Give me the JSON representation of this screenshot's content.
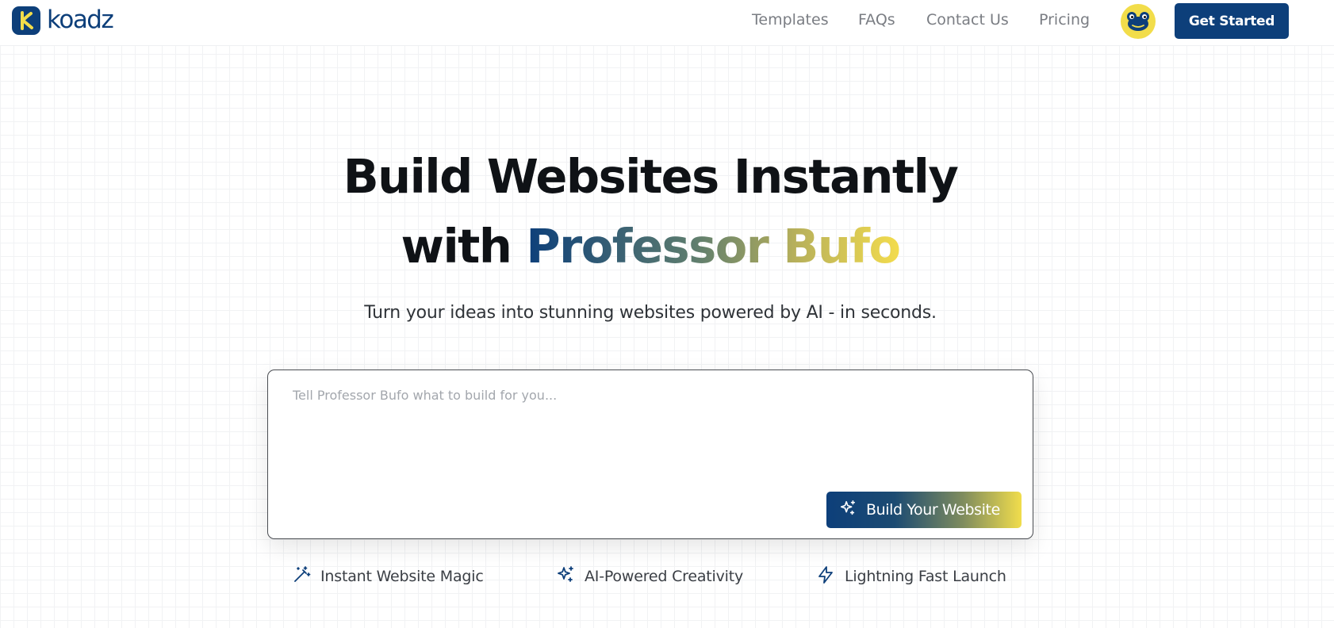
{
  "brand": {
    "name": "koadz",
    "logo_letter": "K",
    "color": "#0d3f7a"
  },
  "nav": {
    "items": [
      "Templates",
      "FAQs",
      "Contact Us",
      "Pricing"
    ],
    "cta_label": "Get Started"
  },
  "hero": {
    "title_line1": "Build Websites Instantly",
    "title_line2_prefix": "with",
    "title_line2_highlight": "Professor Bufo",
    "subtitle": "Turn your ideas into stunning websites powered by AI - in seconds."
  },
  "prompt": {
    "placeholder": "Tell Professor Bufo what to build for you...",
    "value": "",
    "button_label": "Build Your Website"
  },
  "features": [
    {
      "label": "Instant Website Magic",
      "icon": "magic-wand-icon"
    },
    {
      "label": "AI-Powered Creativity",
      "icon": "sparkles-icon"
    },
    {
      "label": "Lightning Fast Launch",
      "icon": "lightning-icon"
    }
  ],
  "colors": {
    "primary": "#0d3f7a",
    "accent_yellow": "#f2dd4a",
    "nav_text": "#7a7d83"
  }
}
